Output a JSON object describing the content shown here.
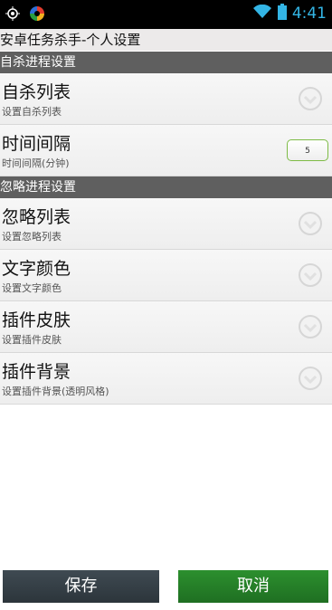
{
  "status": {
    "time": "4:41",
    "icons": [
      "location-icon",
      "app-logo-icon",
      "wifi-icon",
      "battery-icon"
    ]
  },
  "title": "安卓任务杀手-个人设置",
  "sections": {
    "self_kill": "自杀进程设置",
    "ignore": "忽略进程设置"
  },
  "rows": {
    "self_kill_list": {
      "title": "自杀列表",
      "subtitle": "设置自杀列表"
    },
    "interval": {
      "title": "时间间隔",
      "subtitle": "时间间隔(分钟)",
      "value": "5"
    },
    "ignore_list": {
      "title": "忽略列表",
      "subtitle": "设置忽略列表"
    },
    "text_color": {
      "title": "文字颜色",
      "subtitle": "设置文字颜色"
    },
    "widget_skin": {
      "title": "插件皮肤",
      "subtitle": "设置插件皮肤"
    },
    "widget_bg": {
      "title": "插件背景",
      "subtitle": "设置插件背景(透明风格)"
    }
  },
  "buttons": {
    "save": "保存",
    "cancel": "取消"
  },
  "colors": {
    "accent_blue": "#33b5e5",
    "section_gray": "#5f5f5f",
    "save_bg": "#353f45",
    "cancel_bg": "#268228",
    "value_border": "#7dbb45"
  }
}
